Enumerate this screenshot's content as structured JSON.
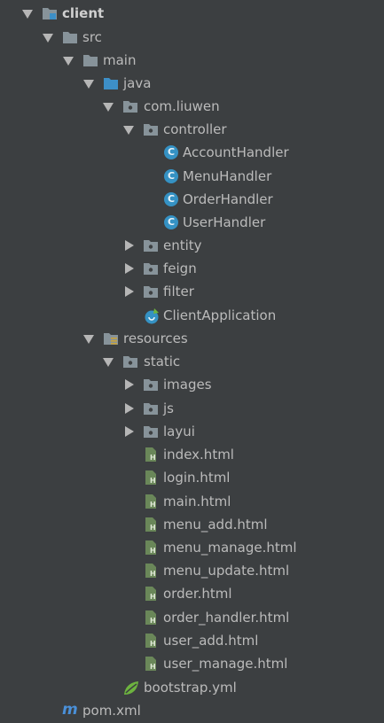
{
  "tree": {
    "client": "client",
    "src": "src",
    "main": "main",
    "java": "java",
    "package": "com.liuwen",
    "controller": "controller",
    "controller_items": [
      "AccountHandler",
      "MenuHandler",
      "OrderHandler",
      "UserHandler"
    ],
    "class_badge": "C",
    "entity": "entity",
    "feign": "feign",
    "filter": "filter",
    "client_application": "ClientApplication",
    "resources": "resources",
    "static": "static",
    "images": "images",
    "js": "js",
    "layui": "layui",
    "html_files": [
      "index.html",
      "login.html",
      "main.html",
      "menu_add.html",
      "menu_manage.html",
      "menu_update.html",
      "order.html",
      "order_handler.html",
      "user_add.html",
      "user_manage.html"
    ],
    "html_badge": "H",
    "bootstrap": "bootstrap.yml",
    "pom": "pom.xml",
    "pom_badge": "m"
  },
  "colors": {
    "background": "#3c3f41",
    "text": "#bbbbbb",
    "folder": "#87939a",
    "java_folder": "#3d8fc7",
    "class_icon": "#3592c4",
    "html_icon": "#6a8759",
    "pom_icon": "#4a90d9",
    "spring_icon": "#6db33f"
  }
}
